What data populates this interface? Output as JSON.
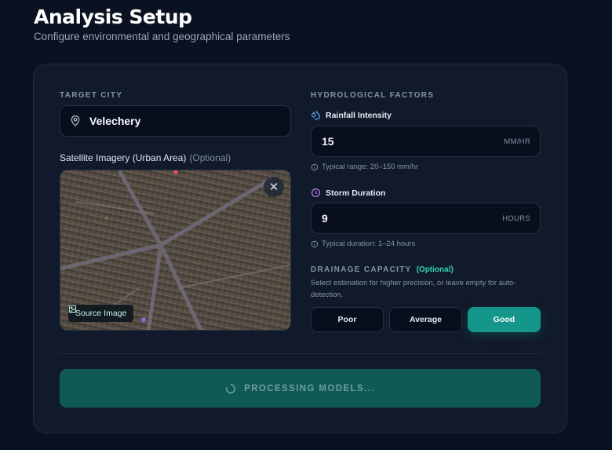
{
  "header": {
    "title": "Analysis Setup",
    "subtitle": "Configure environmental and geographical parameters"
  },
  "target_city": {
    "label": "TARGET CITY",
    "value": "Velechery",
    "icon": "map-pin-icon"
  },
  "satellite": {
    "label": "Satellite Imagery (Urban Area)",
    "optional": "(Optional)",
    "source_badge": "Source Image",
    "remove_icon": "close-icon"
  },
  "hydro": {
    "section_label": "HYDROLOGICAL FACTORS",
    "rainfall": {
      "label": "Rainfall Intensity",
      "value": "15",
      "unit": "MM/HR",
      "hint": "Typical range: 20–150 mm/hr",
      "icon": "droplets-icon",
      "icon_color": "#5aa7f0"
    },
    "storm": {
      "label": "Storm Duration",
      "value": "9",
      "unit": "HOURS",
      "hint": "Typical duration: 1–24 hours",
      "icon": "clock-icon",
      "icon_color": "#b47ff0"
    }
  },
  "drainage": {
    "label": "DRAINAGE CAPACITY",
    "optional": "(Optional)",
    "description": "Select estimation for higher precision, or leave empty for auto-detection.",
    "options": [
      "Poor",
      "Average",
      "Good"
    ],
    "selected": "Good"
  },
  "submit": {
    "label": "PROCESSING MODELS...",
    "accent": "#0f5a56"
  }
}
